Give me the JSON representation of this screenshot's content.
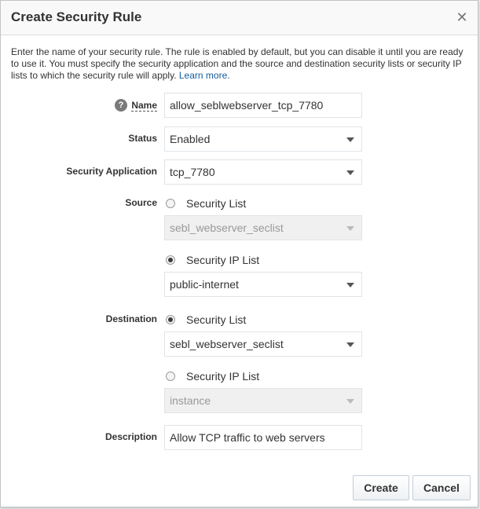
{
  "dialog": {
    "title": "Create Security Rule",
    "close_glyph": "✕",
    "intro_text": "Enter the name of your security rule. The rule is enabled by default, but you can disable it until you are ready to use it. You must specify the security application and the source and destination security lists or security IP lists to which the security rule will apply.",
    "learn_more": "Learn more."
  },
  "form": {
    "help_glyph": "?",
    "name_label": "Name",
    "name_value": "allow_seblwebserver_tcp_7780",
    "status_label": "Status",
    "status_value": "Enabled",
    "security_application_label": "Security Application",
    "security_application_value": "tcp_7780",
    "source_label": "Source",
    "source_security_list_label": "Security List",
    "source_security_list_value": "sebl_webserver_seclist",
    "source_security_ip_list_label": "Security IP List",
    "source_security_ip_list_value": "public-internet",
    "destination_label": "Destination",
    "destination_security_list_label": "Security List",
    "destination_security_list_value": "sebl_webserver_seclist",
    "destination_security_ip_list_label": "Security IP List",
    "destination_security_ip_list_value": "instance",
    "description_label": "Description",
    "description_value": "Allow TCP traffic to web servers"
  },
  "buttons": {
    "create": "Create",
    "cancel": "Cancel"
  }
}
